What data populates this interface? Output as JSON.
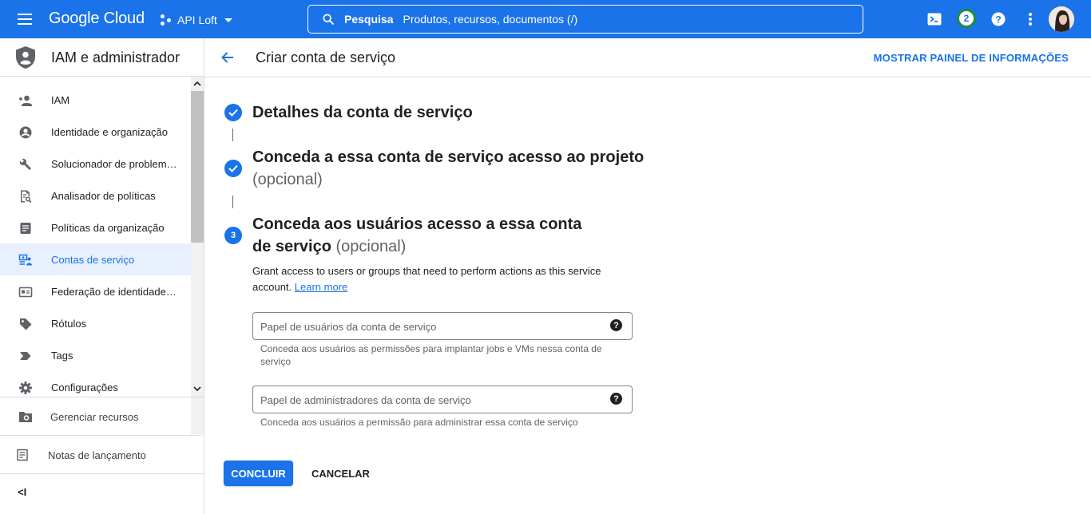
{
  "colors": {
    "brand": "#1a73e8",
    "badge_ring": "#1e8e3e",
    "active_bg": "#e8f0fe"
  },
  "header": {
    "logo": "Google Cloud",
    "project": "API Loft",
    "search_label": "Pesquisa",
    "search_placeholder": "Produtos, recursos, documentos (/)",
    "notifications_count": "2"
  },
  "sidebar": {
    "title": "IAM e administrador",
    "items": [
      {
        "label": "IAM",
        "icon": "person-add-icon"
      },
      {
        "label": "Identidade e organização",
        "icon": "account-circle-icon"
      },
      {
        "label": "Solucionador de problemas de polí",
        "icon": "wrench-icon"
      },
      {
        "label": "Analisador de políticas",
        "icon": "policy-analyzer-icon"
      },
      {
        "label": "Políticas da organização",
        "icon": "document-icon"
      },
      {
        "label": "Contas de serviço",
        "icon": "service-account-icon",
        "active": true
      },
      {
        "label": "Federação de identidade da carga",
        "icon": "id-card-icon"
      },
      {
        "label": "Rótulos",
        "icon": "label-icon"
      },
      {
        "label": "Tags",
        "icon": "tag-icon"
      },
      {
        "label": "Configurações",
        "icon": "gear-icon"
      }
    ],
    "manage_resources": "Gerenciar recursos",
    "release_notes": "Notas de lançamento",
    "collapse": "<I"
  },
  "main": {
    "title": "Criar conta de serviço",
    "info_panel": "MOSTRAR PAINEL DE INFORMAÇÕES",
    "steps": [
      {
        "title": "Detalhes da conta de serviço",
        "status": "done"
      },
      {
        "title": "Conceda a essa conta de serviço acesso ao projeto",
        "optional": "(opcional)",
        "status": "done"
      },
      {
        "number": "3",
        "title": "Conceda aos usuários acesso a essa conta de serviço",
        "optional": "(opcional)",
        "status": "current"
      }
    ],
    "description": "Grant access to users or groups that need to perform actions as this service account.",
    "learn_more": "Learn more",
    "fields": [
      {
        "placeholder": "Papel de usuários da conta de serviço",
        "hint": "Conceda aos usuários as permissões para implantar jobs e VMs nessa conta de serviço"
      },
      {
        "placeholder": "Papel de administradores da conta de serviço",
        "hint": "Conceda aos usuários a permissão para administrar essa conta de serviço"
      }
    ],
    "help_glyph": "?",
    "done_button": "CONCLUIR",
    "cancel_button": "CANCELAR"
  }
}
